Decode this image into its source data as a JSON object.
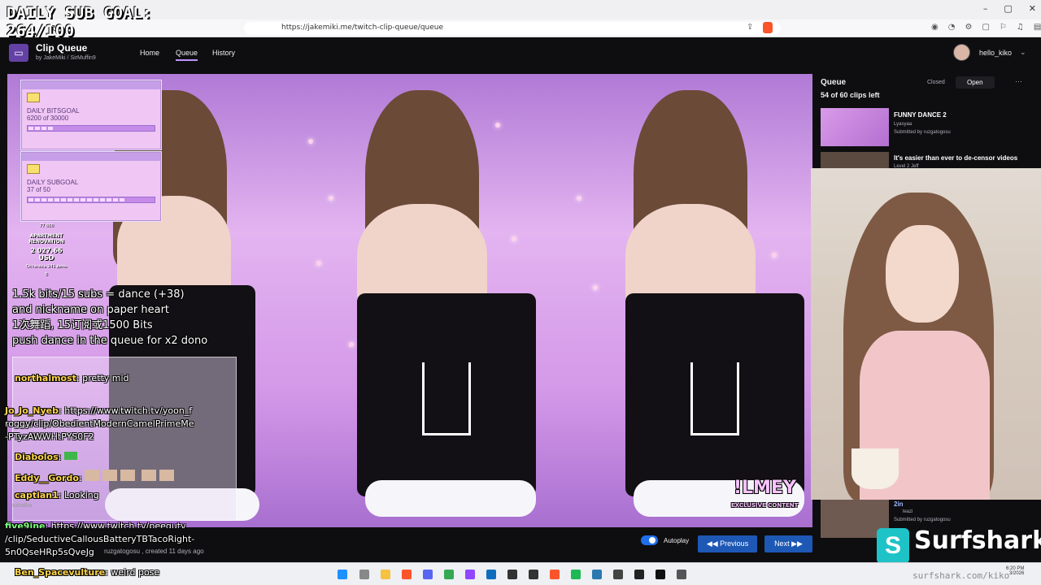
{
  "overlay": {
    "sub_goal": "DAILY SUB GOAL: 264/100",
    "bits_widget": {
      "label": "DAILY BITSGOAL",
      "value": "6200 of 30000"
    },
    "sub_widget": {
      "label": "DAILY SUBGOAL",
      "value": "37 of 50"
    },
    "renovation": {
      "count": "77 000",
      "label": "APARTMENT RENOVATION",
      "amount": "2 027.66 USD",
      "sub": "Осталось 341 день",
      "zero": "0"
    },
    "dance_text": [
      "1.5k bits/15 subs = dance (+38)",
      "and nickname on paper heart",
      "1次舞蹈, 15订阅或1500 Bits",
      "push dance in the queue for x2 dono"
    ],
    "lmey_label": "!LMEY",
    "exclusive_label": "EXCLUSIVE CONTENT",
    "chat": [
      {
        "name": "northalmost",
        "message": "pretty mid",
        "color": "#ffd54a"
      },
      {
        "name": "Jo_Jo_Nyeb",
        "message": "https://www.twitch.tv/yoon_f",
        "color": "#ffd54a"
      },
      {
        "name": "",
        "message": "roggy/clip/ObedientModernCamelPrimeMe",
        "color": "#fff"
      },
      {
        "name": "",
        "message": "-PTyzAWWHtPYS0F2",
        "color": "#fff"
      },
      {
        "name": "Diabolos",
        "message": "",
        "color": "#ffd54a"
      },
      {
        "name": "Eddy__Gordo",
        "message": "",
        "color": "#ffd54a"
      },
      {
        "name": "captian1",
        "message": "Looking",
        "color": "#ffd54a"
      },
      {
        "name": "five9ine",
        "message": "https://www.twitch.tv/peegutv",
        "color": "#7fff7f"
      },
      {
        "name": "",
        "message": "/clip/SeductiveCallousBatteryTBTacoRight-",
        "color": "#fff"
      },
      {
        "name": "",
        "message": "5n0QseHRp5sQveJg",
        "color": "#fff"
      },
      {
        "name": "Ben_Spacevulture",
        "message": "weird pose",
        "color": "#ffd54a"
      }
    ],
    "sabalka": "sabalka"
  },
  "browser": {
    "url": "https://jakemiki.me/twitch-clip-queue/queue"
  },
  "app": {
    "title": "Clip Queue",
    "by_prefix": "by",
    "author1": "JakeMiki",
    "author2": "SirMuffin9",
    "nav": [
      "Home",
      "Queue",
      "History"
    ],
    "username": "hello_kiko"
  },
  "sidebar": {
    "title": "Queue",
    "closed_label": "Closed",
    "open_label": "Open",
    "clips_left": "54 of 60 clips left",
    "clips": [
      {
        "title": "FUNNY DANCE 2",
        "channel": "Lyasyaa",
        "submitted": "Submitted by ruzgatogosu"
      },
      {
        "title": "It's easier than ever to de-censor videos",
        "channel": "Level 2 Jeff",
        "submitted": ""
      },
      {
        "title": "2in",
        "channel": "leazi",
        "submitted": "Submitted by ruzgatogosu"
      }
    ]
  },
  "player": {
    "autoplay_label": "Autoplay",
    "prev_label": "Previous",
    "next_label": "Next",
    "meta": "ruzgatogosu , created 11 days ago"
  },
  "sponsor": {
    "name": "Surfshark",
    "url": "surfshark.com/kiko"
  },
  "taskbar": {
    "time": "6:20 PM",
    "date": "3/2026"
  },
  "colors": {
    "accent": "#bf94ff",
    "button_blue": "#1e58b5",
    "app_bg": "#0e0e10"
  }
}
